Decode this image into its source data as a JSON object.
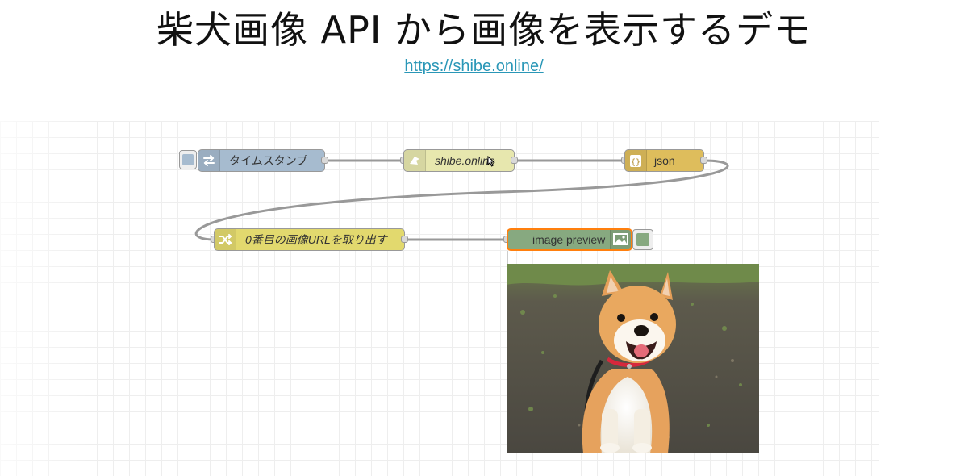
{
  "slide": {
    "title": "柴犬画像 API から画像を表示するデモ",
    "link": "https://shibe.online/"
  },
  "flow": {
    "nodes": [
      {
        "id": "inject",
        "label": "タイムスタンプ",
        "icon": "arrows-shuffle-icon",
        "color": "#a6bbcf"
      },
      {
        "id": "http",
        "label": "shibe.online",
        "icon": "globe-icon",
        "color": "#e7e7ae"
      },
      {
        "id": "json",
        "label": "json",
        "icon": "braces-icon",
        "color": "#debd5c"
      },
      {
        "id": "change",
        "label": "0番目の画像URLを取り出す",
        "icon": "shuffle-icon",
        "color": "#e2d96e"
      },
      {
        "id": "preview",
        "label": "image preview",
        "icon": "image-icon",
        "color": "#87a980"
      }
    ],
    "selected_node_border": "#ff7f0e",
    "wire_color": "#999999"
  }
}
